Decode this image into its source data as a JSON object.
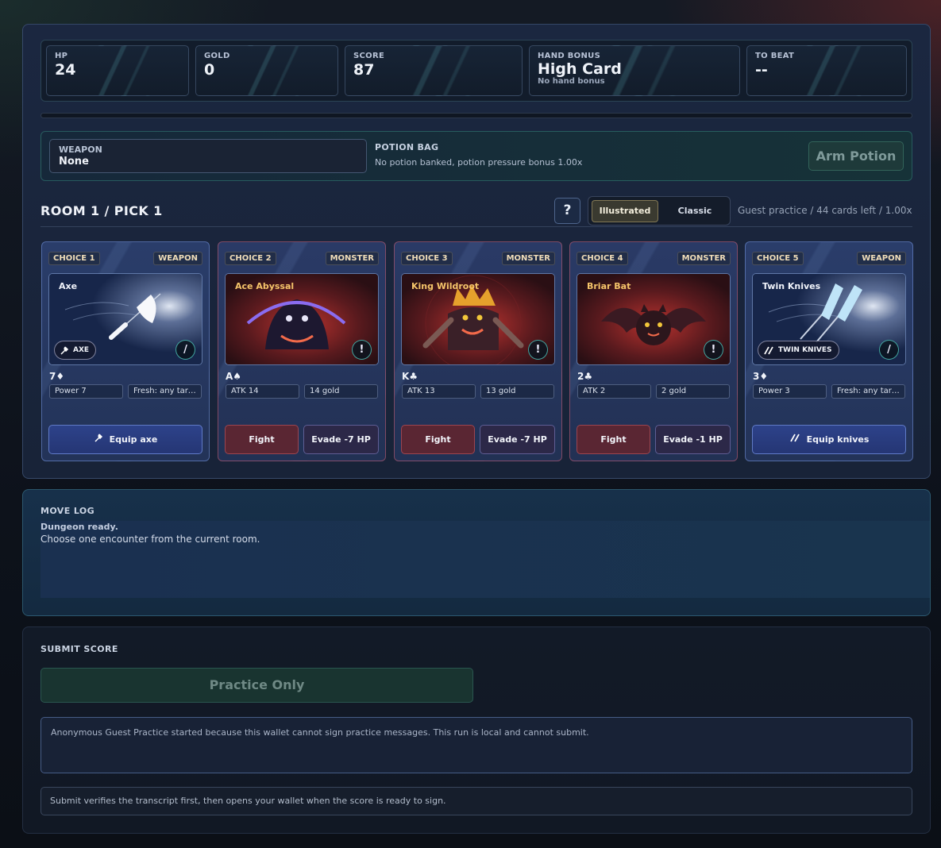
{
  "stats": [
    {
      "label": "HP",
      "value": "24",
      "sub": ""
    },
    {
      "label": "GOLD",
      "value": "0",
      "sub": ""
    },
    {
      "label": "SCORE",
      "value": "87",
      "sub": ""
    },
    {
      "label": "HAND BONUS",
      "value": "High Card",
      "sub": "No hand bonus"
    },
    {
      "label": "TO BEAT",
      "value": "--",
      "sub": ""
    }
  ],
  "gear": {
    "weapon_label": "WEAPON",
    "weapon_value": "None",
    "potion_label": "POTION BAG",
    "potion_value": "No potion banked, potion pressure bonus 1.00x",
    "arm_potion": "Arm Potion"
  },
  "room": {
    "title": "ROOM 1 / PICK 1",
    "help": "?",
    "style_illustrated": "Illustrated",
    "style_classic": "Classic",
    "status": "Guest practice / 44 cards left / 1.00x"
  },
  "cards": [
    {
      "choice": "CHOICE 1",
      "type": "WEAPON",
      "name": "Axe",
      "tag": "AXE",
      "badge": "/",
      "rank": "7♦",
      "stat_a": "Power 7",
      "stat_b": "Fresh: any target",
      "button": "Equip axe"
    },
    {
      "choice": "CHOICE 2",
      "type": "MONSTER",
      "name": "Ace Abyssal",
      "badge": "!",
      "rank": "A♠",
      "stat_a": "ATK 14",
      "stat_b": "14 gold",
      "fight": "Fight",
      "evade": "Evade -7 HP"
    },
    {
      "choice": "CHOICE 3",
      "type": "MONSTER",
      "name": "King Wildroot",
      "badge": "!",
      "rank": "K♣",
      "stat_a": "ATK 13",
      "stat_b": "13 gold",
      "fight": "Fight",
      "evade": "Evade -7 HP"
    },
    {
      "choice": "CHOICE 4",
      "type": "MONSTER",
      "name": "Briar Bat",
      "badge": "!",
      "rank": "2♣",
      "stat_a": "ATK 2",
      "stat_b": "2 gold",
      "fight": "Fight",
      "evade": "Evade -1 HP"
    },
    {
      "choice": "CHOICE 5",
      "type": "WEAPON",
      "name": "Twin Knives",
      "tag": "TWIN KNIVES",
      "badge": "/",
      "rank": "3♦",
      "stat_a": "Power 3",
      "stat_b": "Fresh: any target",
      "button": "Equip knives"
    }
  ],
  "log": {
    "title": "MOVE LOG",
    "head": "Dungeon ready.",
    "line": "Choose one encounter from the current room."
  },
  "submit": {
    "title": "SUBMIT SCORE",
    "button": "Practice Only",
    "guest_note": "Anonymous Guest Practice started because this wallet cannot sign practice messages. This run is local and cannot submit.",
    "verify_note": "Submit verifies the transcript first, then opens your wallet when the score is ready to sign."
  },
  "colors": {
    "monster_name": "#f5c56a",
    "fight_bg": "#5a2633",
    "equip_bg": "#2d428a"
  }
}
